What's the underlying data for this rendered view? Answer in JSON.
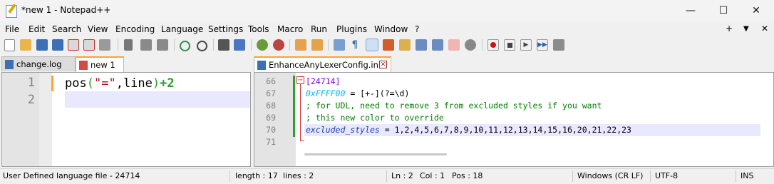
{
  "window": {
    "title": "*new 1 - Notepad++",
    "minimize": "—",
    "maximize": "☐",
    "close": "✕"
  },
  "menu": [
    "File",
    "Edit",
    "Search",
    "View",
    "Encoding",
    "Language",
    "Settings",
    "Tools",
    "Macro",
    "Run",
    "Plugins",
    "Window",
    "?"
  ],
  "menu_right": {
    "plus": "+",
    "dropdown": "▼",
    "close": "✕"
  },
  "left_tabs": [
    {
      "label": "change.log",
      "active": false
    },
    {
      "label": "new 1",
      "active": true
    }
  ],
  "right_tabs": [
    {
      "label": "EnhanceAnyLexerConfig.ini",
      "active": true
    }
  ],
  "left_editor": {
    "line_numbers": [
      "1",
      "2"
    ],
    "line1": {
      "func": "pos",
      "open": "(",
      "str": "\"=\"",
      "comma": ",",
      "arg": "line",
      "close": ")",
      "plus": "+",
      "num": "2"
    }
  },
  "right_editor": {
    "line_numbers": [
      "66",
      "67",
      "68",
      "69",
      "70",
      "71"
    ],
    "fold_marker": "−",
    "lines": {
      "l66": "[24714]",
      "l67_key": "0xFFFF00",
      "l67_rest": " = [+-](?=\\d)",
      "l68": "; for UDL, need to remove 3 from excluded styles if you want",
      "l69": "; this new color to override",
      "l70_key": "excluded_styles",
      "l70_rest": " = 1,2,4,5,6,7,8,9,10,11,12,13,14,15,16,20,21,22,23"
    }
  },
  "status": {
    "filetype": "User Defined language file - 24714",
    "length": "length : 17",
    "lines": "lines : 2",
    "ln": "Ln : 2",
    "col": "Col : 1",
    "pos": "Pos : 18",
    "eol": "Windows (CR LF)",
    "encoding": "UTF-8",
    "mode": "INS"
  }
}
